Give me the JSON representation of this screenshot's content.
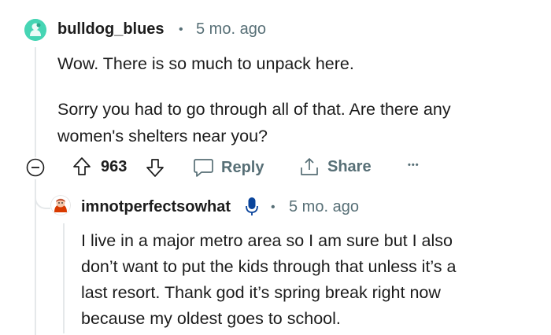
{
  "comment": {
    "username": "bulldog_blues",
    "separator": "•",
    "time": "5 mo. ago",
    "paragraphs": [
      "Wow. There is so much to unpack here.",
      "Sorry you had to go through all of that. Are there any",
      "women's shelters near you?"
    ],
    "score": "963",
    "reply_label": "Reply",
    "share_label": "Share",
    "more_label": "•••"
  },
  "reply": {
    "username": "imnotperfectsowhat",
    "separator": "•",
    "time": "5 mo. ago",
    "lines": [
      "I live in a major metro area so I am sure but I also",
      "don’t want to put the kids through that unless it’s a",
      "last resort. Thank god it’s spring break right now",
      "because my oldest goes to school."
    ]
  },
  "colors": {
    "avatar1": "#46d5b4",
    "meta": "#576f76",
    "text": "#1c1c1c",
    "thread": "#e5e8ea",
    "mic": "#0a449b"
  },
  "icons": [
    "collapse-icon",
    "upvote-icon",
    "downvote-icon",
    "comment-icon",
    "share-icon",
    "more-icon",
    "microphone-icon"
  ]
}
